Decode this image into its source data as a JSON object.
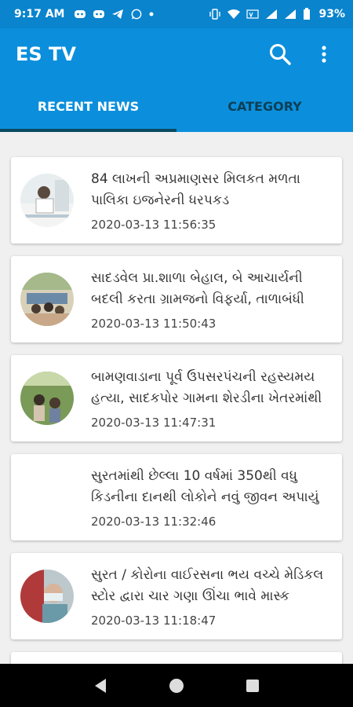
{
  "status_bar": {
    "time": "9:17 AM",
    "battery": "93%"
  },
  "app_bar": {
    "title": "ES TV"
  },
  "tabs": [
    {
      "label": "RECENT NEWS",
      "active": true
    },
    {
      "label": "CATEGORY",
      "active": false
    }
  ],
  "news": [
    {
      "title": "84 લાખની અપ્રમાણસર મિલકત મળતા પાલિકા ઇજનેરની ધરપકડ",
      "date": "2020-03-13 11:56:35",
      "has_thumb": true
    },
    {
      "title": " સાદડવેલ પ્રા.શાળા બેહાલ, બે આચાર્યની બદલી કરતા ગ્રામજનો વિફર્યા, તાળાબંધી",
      "date": "2020-03-13 11:50:43",
      "has_thumb": true
    },
    {
      "title": " બામણવાડાના પૂર્વ ઉપસરપંચની રહસ્યમય હત્યા, સાદકપોર ગામના શેરડીના ખેતરમાંથી",
      "date": "2020-03-13 11:47:31",
      "has_thumb": true
    },
    {
      "title": "સુરતમાંથી છેલ્લા 10 વર્ષમાં 350થી વધુ કિડનીના દાનથી લોકોને નવું જીવન અપાયું",
      "date": "2020-03-13 11:32:46",
      "has_thumb": false
    },
    {
      "title": "સુરત / કોરોના વાઈરસના ભય વચ્ચે મેડિકલ સ્ટોર દ્વારા ચાર ગણા ઊંચા ભાવે માસ્ક",
      "date": "2020-03-13 11:18:47",
      "has_thumb": true
    }
  ],
  "colors": {
    "primary": "#0b8fdc",
    "status": "#0a84cd",
    "indicator": "#0a4a62"
  }
}
